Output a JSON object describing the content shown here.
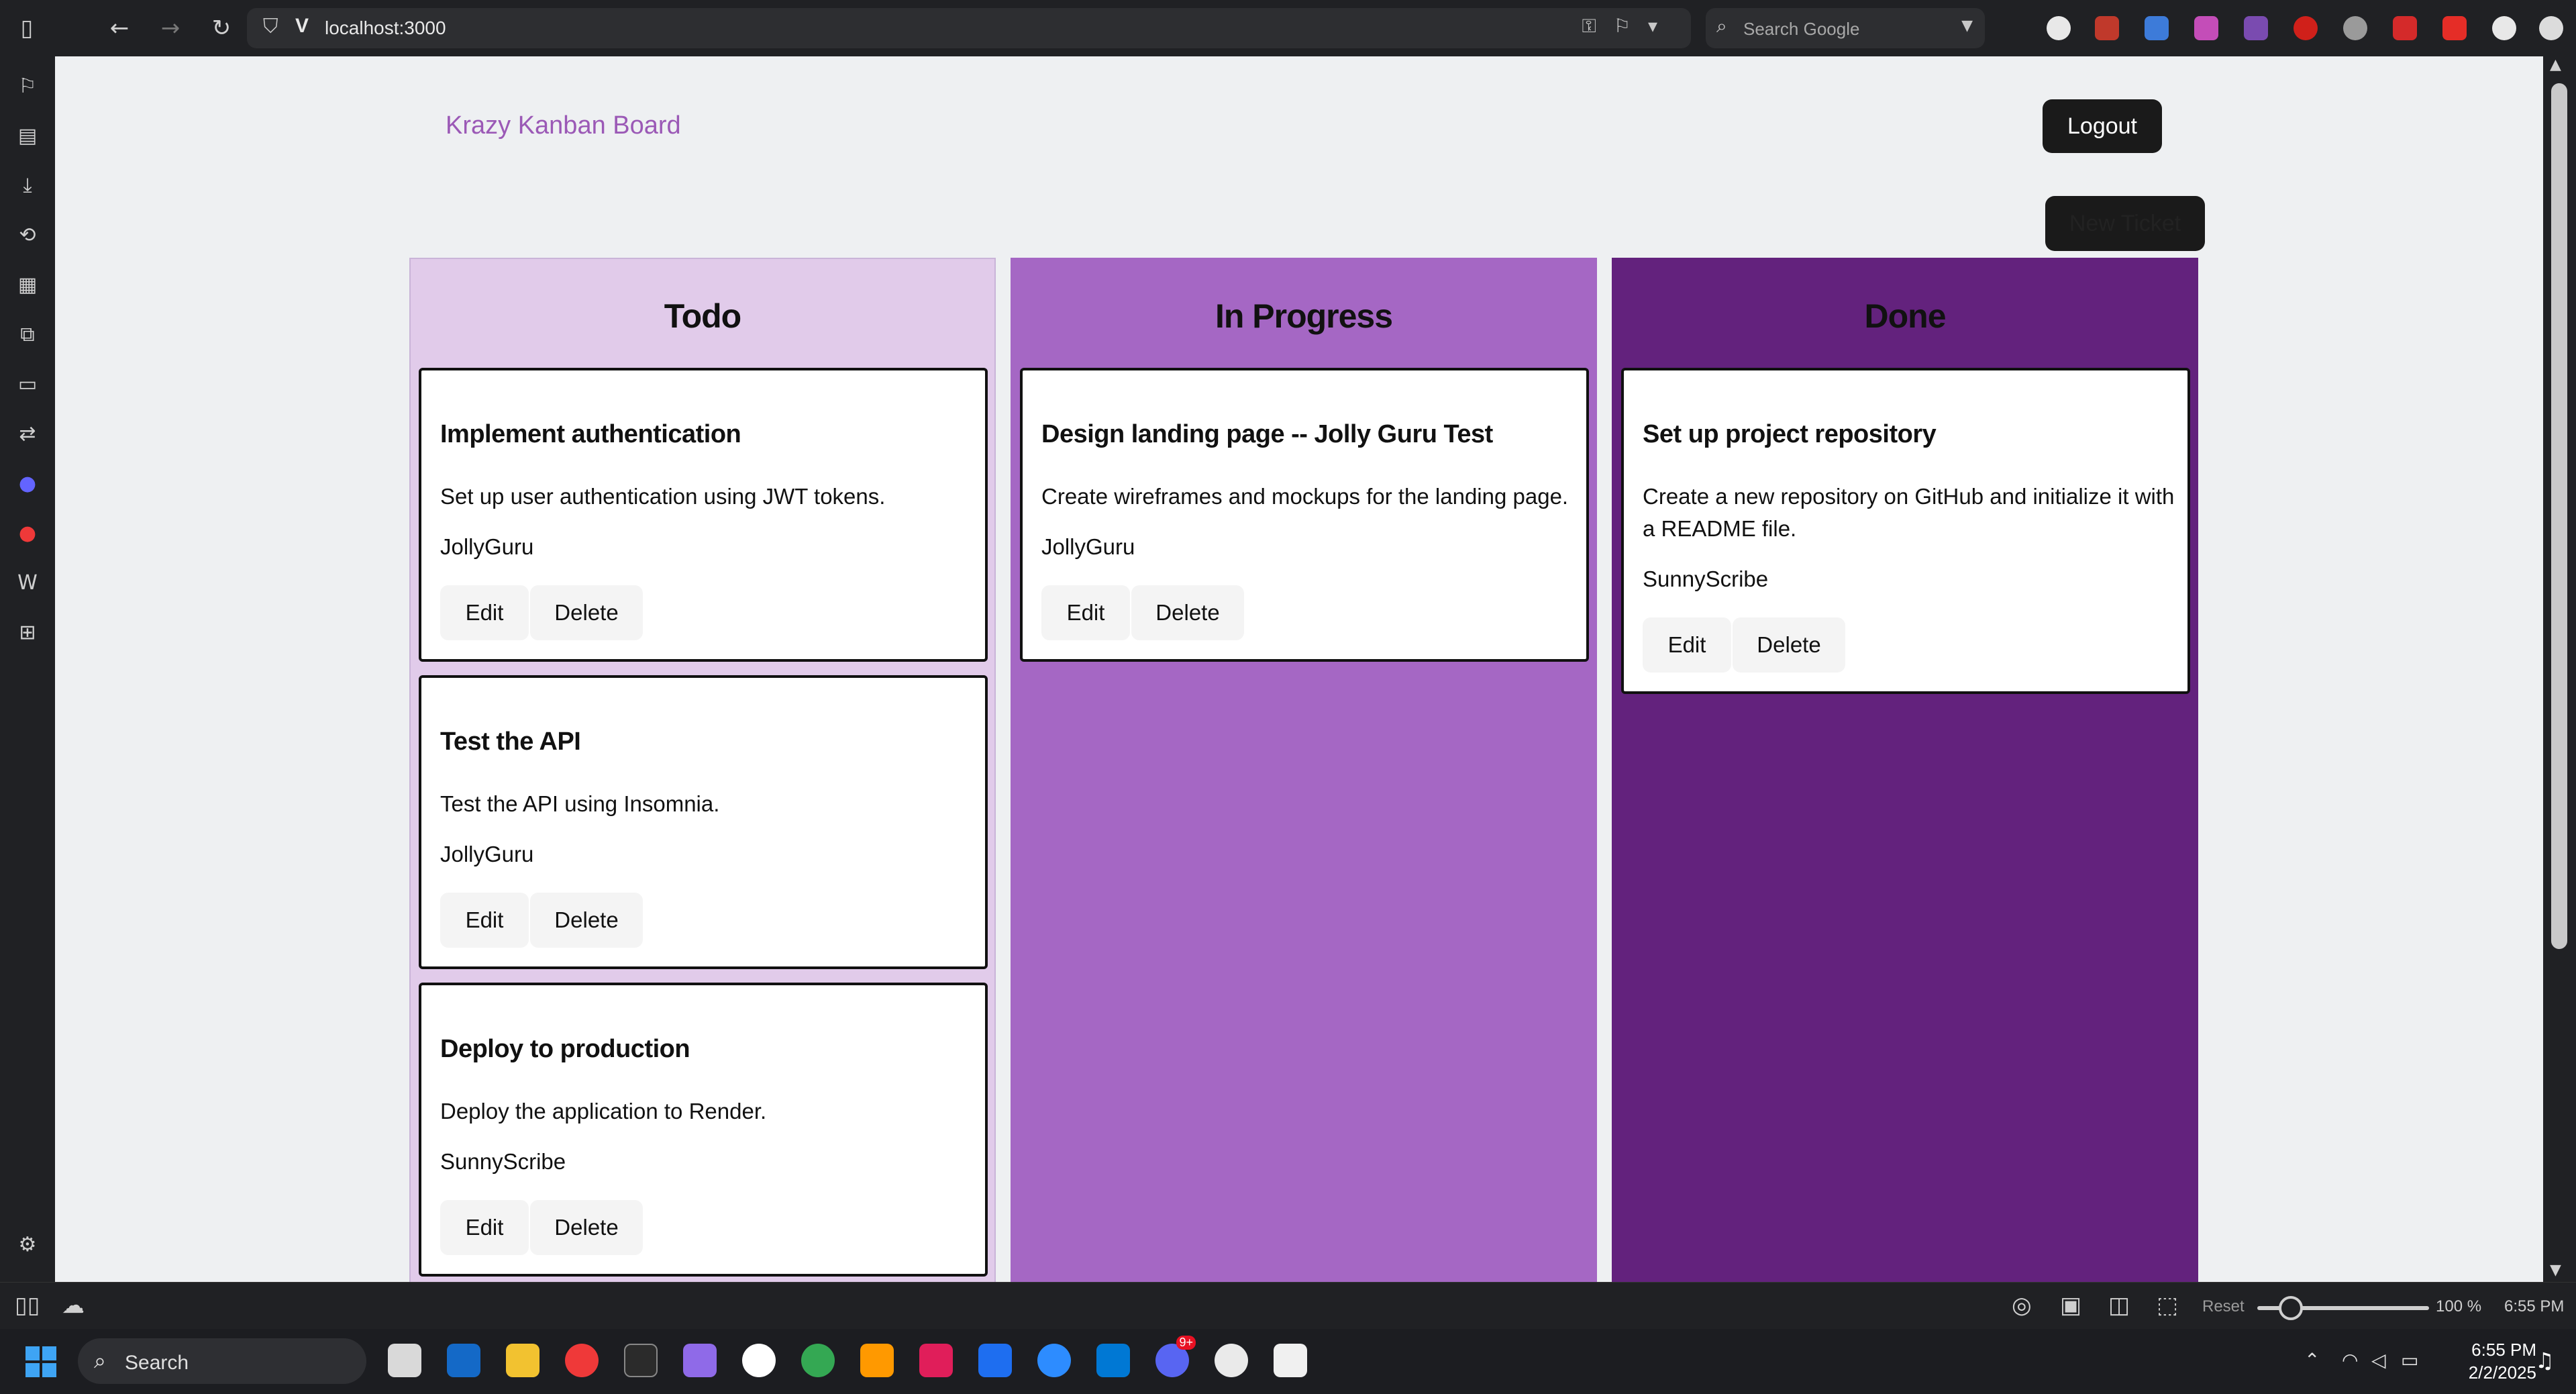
{
  "browser": {
    "url": "localhost:3000",
    "url_prefix": "V",
    "search_placeholder": "Search Google"
  },
  "app": {
    "title": "Krazy Kanban Board",
    "logout_label": "Logout",
    "new_ticket_label": "New Ticket"
  },
  "columns": [
    {
      "title": "Todo",
      "cards": [
        {
          "title": "Implement authentication",
          "description": "Set up user authentication using JWT tokens.",
          "user": "JollyGuru",
          "edit": "Edit",
          "delete": "Delete"
        },
        {
          "title": "Test the API",
          "description": "Test the API using Insomnia.",
          "user": "JollyGuru",
          "edit": "Edit",
          "delete": "Delete"
        },
        {
          "title": "Deploy to production",
          "description": "Deploy the application to Render.",
          "user": "SunnyScribe",
          "edit": "Edit",
          "delete": "Delete"
        }
      ]
    },
    {
      "title": "In Progress",
      "cards": [
        {
          "title": "Design landing page -- Jolly Guru Test",
          "description": "Create wireframes and mockups for the landing page.",
          "user": "JollyGuru",
          "edit": "Edit",
          "delete": "Delete"
        }
      ]
    },
    {
      "title": "Done",
      "cards": [
        {
          "title": "Set up project repository",
          "description": "Create a new repository on GitHub and initialize it with a README file.",
          "user": "SunnyScribe",
          "edit": "Edit",
          "delete": "Delete"
        }
      ]
    }
  ],
  "statusbar": {
    "reset_label": "Reset",
    "zoom": "100 %",
    "time": "6:55 PM"
  },
  "taskbar": {
    "search_label": "Search",
    "clock_time": "6:55 PM",
    "clock_date": "2/2/2025",
    "discord_badge": "9+"
  },
  "colors": {
    "todo": "#e1cbea",
    "in_progress": "#a567c4",
    "done": "#63227d",
    "title_accent": "#9b59b6"
  }
}
